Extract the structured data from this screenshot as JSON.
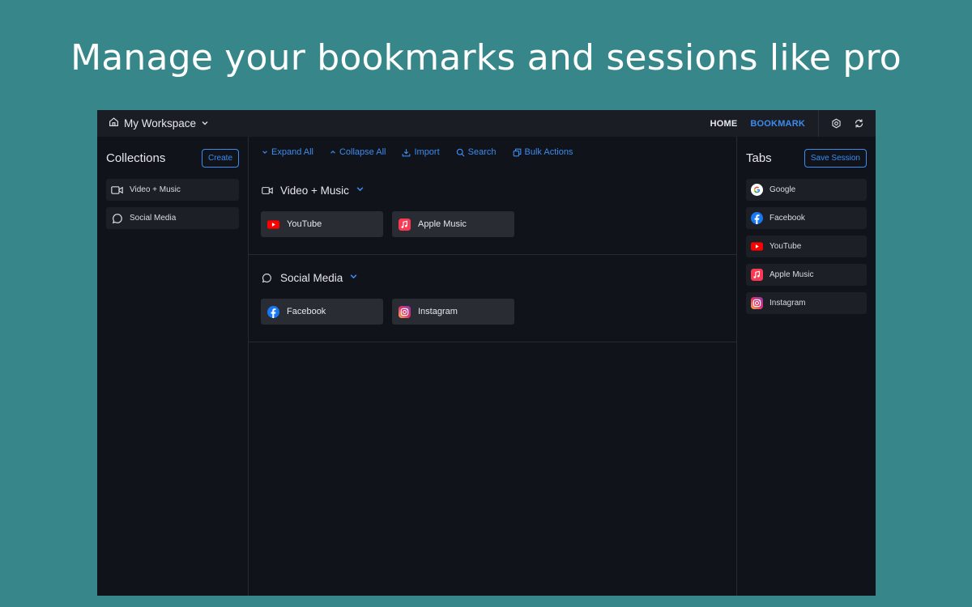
{
  "hero": {
    "title": "Manage your bookmarks and sessions like pro"
  },
  "topbar": {
    "workspace": "My Workspace",
    "nav": {
      "home": "HOME",
      "bookmark": "BOOKMARK"
    }
  },
  "collections": {
    "title": "Collections",
    "create_label": "Create",
    "items": [
      {
        "label": "Video + Music",
        "icon": "video-icon"
      },
      {
        "label": "Social Media",
        "icon": "chat-bubble-icon"
      }
    ]
  },
  "toolbar": {
    "expand": "Expand All",
    "collapse": "Collapse All",
    "import": "Import",
    "search": "Search",
    "bulk": "Bulk Actions"
  },
  "groups": [
    {
      "name": "Video + Music",
      "icon": "video-icon",
      "bookmarks": [
        {
          "label": "YouTube",
          "icon": "youtube-icon"
        },
        {
          "label": "Apple Music",
          "icon": "apple-music-icon"
        }
      ]
    },
    {
      "name": "Social Media",
      "icon": "chat-bubble-icon",
      "bookmarks": [
        {
          "label": "Facebook",
          "icon": "facebook-icon"
        },
        {
          "label": "Instagram",
          "icon": "instagram-icon"
        }
      ]
    }
  ],
  "tabs": {
    "title": "Tabs",
    "save_label": "Save Session",
    "items": [
      {
        "label": "Google",
        "icon": "google-icon"
      },
      {
        "label": "Facebook",
        "icon": "facebook-icon"
      },
      {
        "label": "YouTube",
        "icon": "youtube-icon"
      },
      {
        "label": "Apple Music",
        "icon": "apple-music-icon"
      },
      {
        "label": "Instagram",
        "icon": "instagram-icon"
      }
    ]
  },
  "colors": {
    "background": "#37878a",
    "window": "#10131a",
    "topbar": "#1a1d24",
    "accent": "#3b8cf0",
    "card": "#292c33",
    "list_item": "#1c1f26"
  }
}
